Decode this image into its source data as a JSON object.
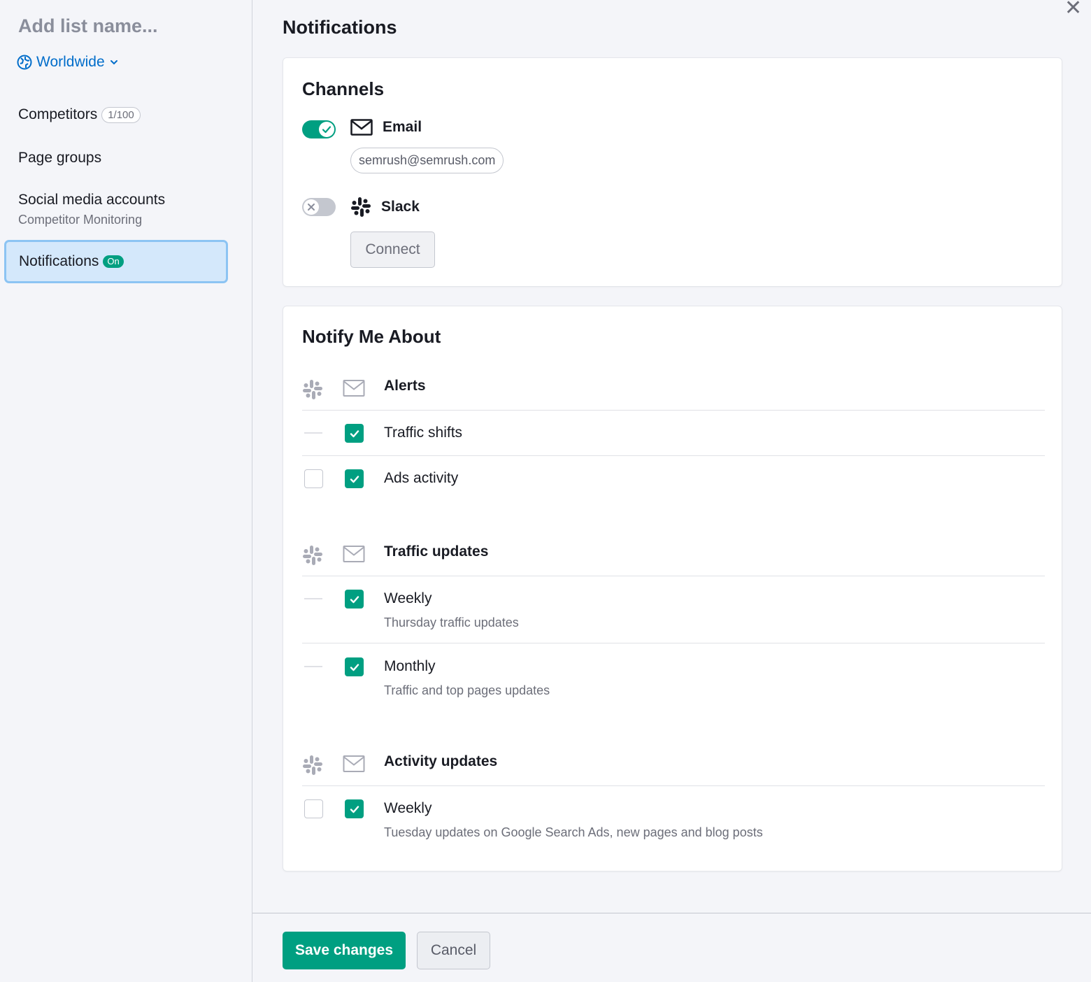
{
  "sidebar": {
    "list_name_placeholder": "Add list name...",
    "region": "Worldwide",
    "items": {
      "competitors": {
        "label": "Competitors",
        "count": "1/100"
      },
      "page_groups": {
        "label": "Page groups"
      },
      "social": {
        "label": "Social media accounts",
        "sub": "Competitor Monitoring"
      },
      "notifications": {
        "label": "Notifications",
        "badge": "On"
      }
    }
  },
  "main": {
    "title": "Notifications",
    "close": "✕"
  },
  "channels": {
    "title": "Channels",
    "email": {
      "label": "Email",
      "enabled": true,
      "address": "semrush@semrush.com"
    },
    "slack": {
      "label": "Slack",
      "enabled": false,
      "connect_label": "Connect"
    }
  },
  "notify": {
    "title": "Notify Me About",
    "groups": {
      "alerts": {
        "title": "Alerts",
        "items": [
          {
            "label": "Traffic shifts",
            "slack": "n/a",
            "email": true
          },
          {
            "label": "Ads activity",
            "slack": false,
            "email": true
          }
        ]
      },
      "traffic": {
        "title": "Traffic updates",
        "items": [
          {
            "label": "Weekly",
            "sub": "Thursday traffic updates",
            "slack": "n/a",
            "email": true
          },
          {
            "label": "Monthly",
            "sub": "Traffic and top pages updates",
            "slack": "n/a",
            "email": true
          }
        ]
      },
      "activity": {
        "title": "Activity updates",
        "items": [
          {
            "label": "Weekly",
            "sub": "Tuesday updates on Google Search Ads, new pages and blog posts",
            "slack": false,
            "email": true
          }
        ]
      }
    }
  },
  "footer": {
    "save_label": "Save changes",
    "cancel_label": "Cancel"
  },
  "colors": {
    "accent": "#009f81",
    "link": "#006dca",
    "active_nav_bg": "#d4e8fb",
    "active_nav_border": "#8cc4f3"
  }
}
